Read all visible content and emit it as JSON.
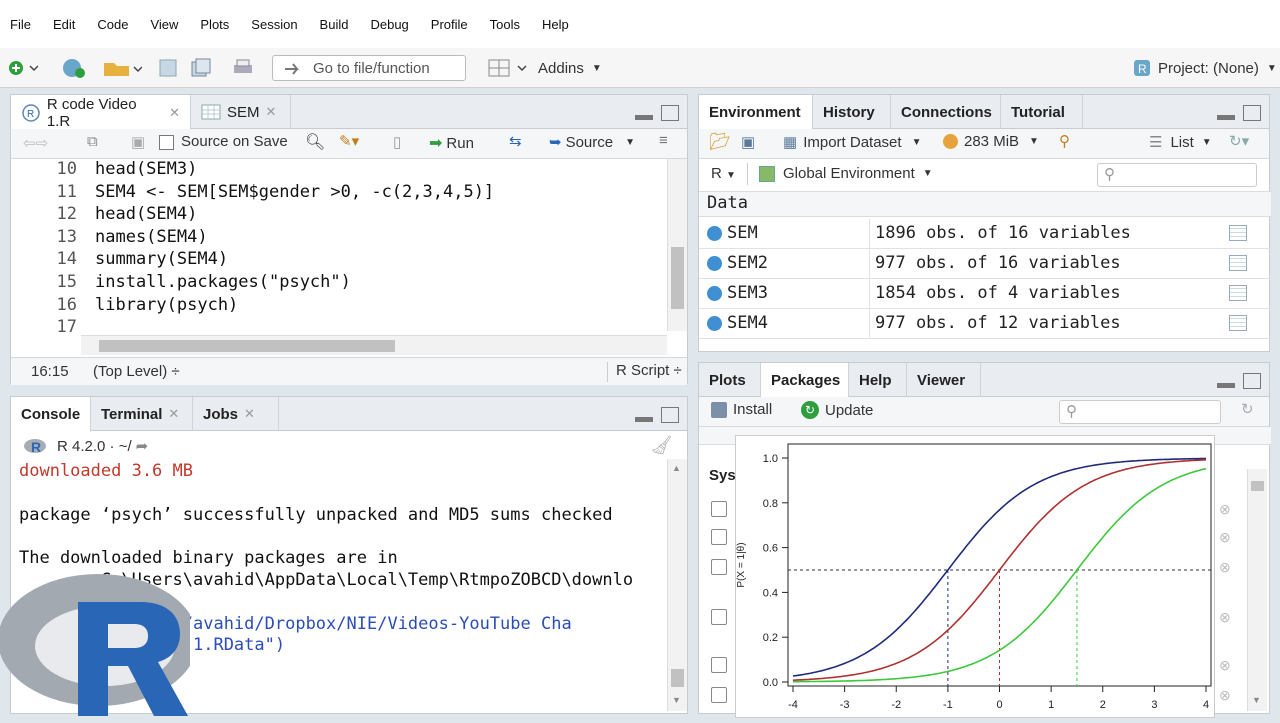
{
  "menu": [
    "File",
    "Edit",
    "Code",
    "View",
    "Plots",
    "Session",
    "Build",
    "Debug",
    "Profile",
    "Tools",
    "Help"
  ],
  "toolbar": {
    "goto_placeholder": "Go to file/function",
    "addins": "Addins",
    "project": "Project: (None)"
  },
  "editor": {
    "tabs": [
      {
        "label": "R code Video 1.R"
      },
      {
        "label": "SEM"
      }
    ],
    "source_on_save": "Source on Save",
    "run": "Run",
    "source": "Source",
    "lines": [
      {
        "n": "10",
        "t": "head(SEM3)"
      },
      {
        "n": "11",
        "t": "SEM4 <- SEM[SEM$gender >0, -c(2,3,4,5)]"
      },
      {
        "n": "12",
        "t": "head(SEM4)"
      },
      {
        "n": "13",
        "t": "names(SEM4)"
      },
      {
        "n": "14",
        "t": "summary(SEM4)"
      },
      {
        "n": "15",
        "t": "install.packages(\"psych\")"
      },
      {
        "n": "16",
        "t": "library(psych)"
      },
      {
        "n": "17",
        "t": ""
      }
    ],
    "status_pos": "16:15",
    "status_scope": "(Top Level) ÷",
    "status_lang": "R Script ÷"
  },
  "console": {
    "tabs": [
      {
        "label": "Console"
      },
      {
        "label": "Terminal"
      },
      {
        "label": "Jobs"
      }
    ],
    "version": "R 4.2.0 · ~/",
    "lines": [
      "downloaded 3.6 MB",
      "",
      "package ‘psych’ successfully unpacked and MD5 sums checked",
      "",
      "The downloaded binary packages are in",
      "        C:\\Users\\avahid\\AppData\\Local\\Temp\\RtmpoZOBCD\\downlo",
      "        ",
      "         :/Users/avahid/Dropbox/NIE/Videos-YouTube Cha",
      "         t Video 1.RData\")"
    ]
  },
  "environment": {
    "tabs": [
      {
        "label": "Environment"
      },
      {
        "label": "History"
      },
      {
        "label": "Connections"
      },
      {
        "label": "Tutorial"
      }
    ],
    "import": "Import Dataset",
    "memory": "283 MiB",
    "list": "List",
    "lang": "R",
    "scope": "Global Environment",
    "section": "Data",
    "rows": [
      {
        "name": "SEM",
        "value": "1896 obs. of 16 variables"
      },
      {
        "name": "SEM2",
        "value": "977 obs. of 16 variables"
      },
      {
        "name": "SEM3",
        "value": "1854 obs. of 4 variables"
      },
      {
        "name": "SEM4",
        "value": "977 obs. of 12 variables"
      }
    ]
  },
  "packages": {
    "tabs": [
      {
        "label": "Plots"
      },
      {
        "label": "Packages"
      },
      {
        "label": "Help"
      },
      {
        "label": "Viewer"
      }
    ],
    "install": "Install",
    "update": "Update",
    "section_partial": "Sys"
  },
  "chart_data": {
    "type": "line",
    "title": "",
    "xlabel": "",
    "ylabel": "P(X = 1|θ)",
    "xlim": [
      -4,
      4
    ],
    "ylim": [
      0,
      1
    ],
    "xticks": [
      "-4",
      "-3",
      "-2",
      "-1",
      "0",
      "1",
      "2",
      "3",
      "4"
    ],
    "yticks": [
      "0.0",
      "0.2",
      "0.4",
      "0.6",
      "0.8",
      "1.0"
    ],
    "series": [
      {
        "color": "#1f2a7a",
        "b": -1,
        "a": 1.2
      },
      {
        "color": "#b03030",
        "b": 0,
        "a": 1.2
      },
      {
        "color": "#3cc83c",
        "b": 1.5,
        "a": 1.2
      }
    ],
    "reference_line_y": 0.5,
    "reference_lines_x": [
      {
        "x": -1,
        "color": "#1f2a7a"
      },
      {
        "x": 0,
        "color": "#b03030"
      },
      {
        "x": 1.5,
        "color": "#3cc83c"
      }
    ]
  },
  "colors": {
    "r_blue": "#2a66b6",
    "r_gray": "#9aa0a8"
  }
}
